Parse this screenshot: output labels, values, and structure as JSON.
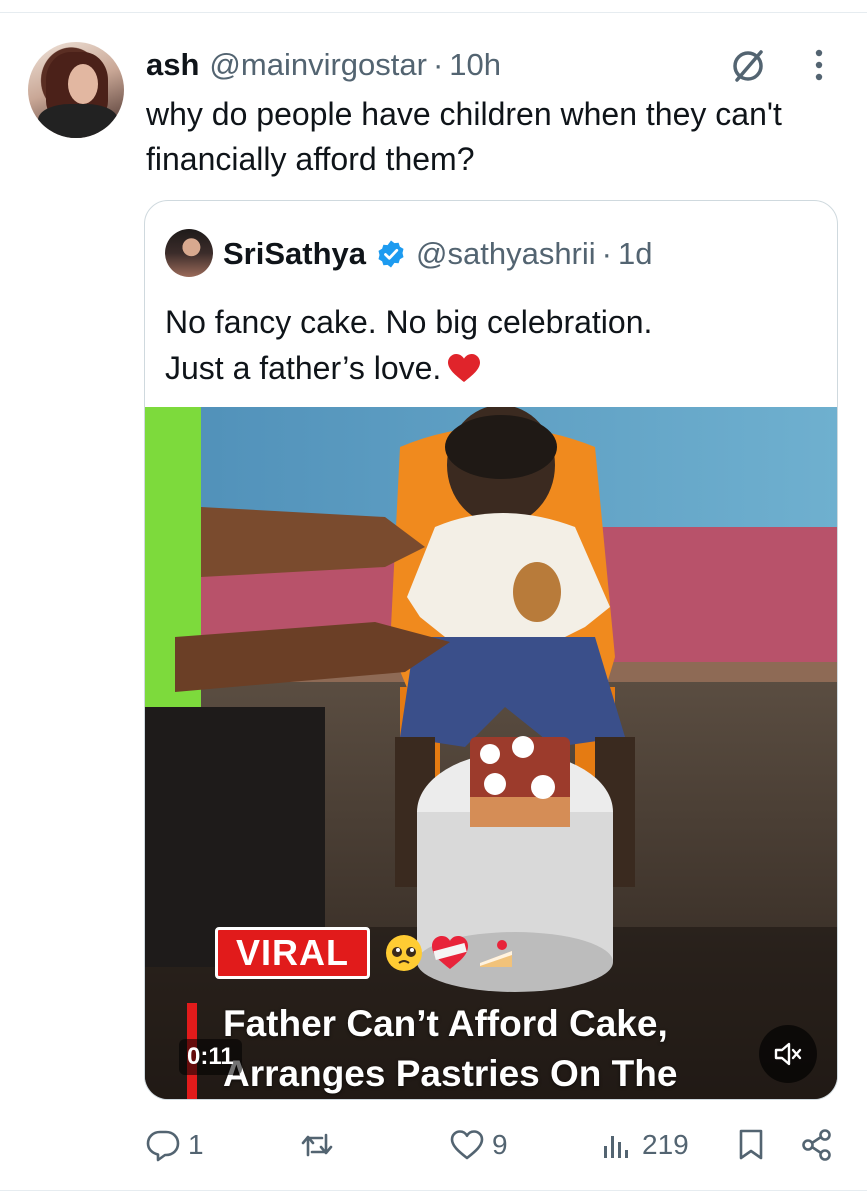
{
  "tweet": {
    "author_name": "ash",
    "author_handle": "@mainvirgostar",
    "separator": "·",
    "time": "10h",
    "text": "why do people have children when they can't financially afford them?"
  },
  "quoted": {
    "author_name": "SriSathya",
    "author_handle": "@sathyashrii",
    "separator": "·",
    "time": "1d",
    "text_line1": "No fancy cake. No big celebration.",
    "text_line2": "Just a father’s love.",
    "video": {
      "viral_badge": "VIRAL",
      "headline_line1": "Father Can’t Afford Cake,",
      "headline_line2": "Arranges Pastries On The",
      "duration": "0:11"
    }
  },
  "actions": {
    "replies": "1",
    "reposts": "",
    "likes": "9",
    "views": "219"
  },
  "colors": {
    "text_primary": "#0f1419",
    "text_secondary": "#536471",
    "verified_blue": "#1d9bf0",
    "viral_red": "#e11b1b",
    "border": "#cfd9de"
  },
  "icons": [
    "grok-icon",
    "more-icon",
    "verified-icon",
    "heart-emoji",
    "mute-icon",
    "reply-icon",
    "repost-icon",
    "like-icon",
    "views-icon",
    "bookmark-icon",
    "share-icon"
  ]
}
